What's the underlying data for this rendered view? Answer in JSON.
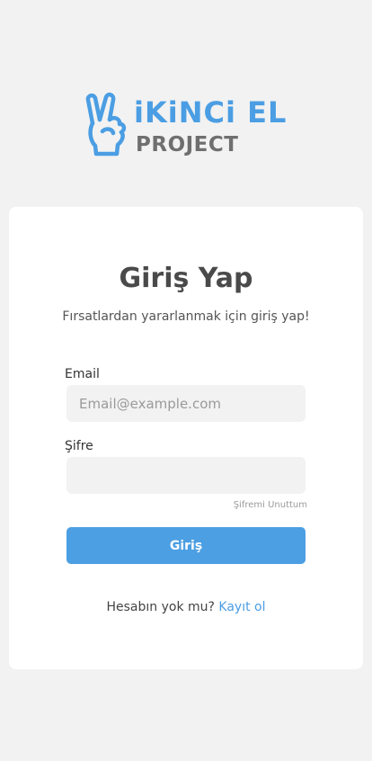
{
  "brand": {
    "logo_icon": "hand-two-fingers-icon",
    "title": "iKiNCi EL",
    "subtitle": "PROJECT",
    "colors": {
      "primary": "#4b9ee3",
      "secondary": "#6f6f6f"
    }
  },
  "login": {
    "heading": "Giriş Yap",
    "subheading": "Fırsatlardan yararlanmak için giriş yap!",
    "email_label": "Email",
    "email_placeholder": "Email@example.com",
    "email_value": "",
    "password_label": "Şifre",
    "password_value": "",
    "forgot_password": "Şifremi Unuttum",
    "submit_label": "Giriş",
    "no_account_text": "Hesabın yok mu?",
    "signup_link": "Kayıt ol"
  },
  "colors": {
    "page_background": "#f2f2f2",
    "card_background": "#ffffff",
    "button_background": "#4c9fe3",
    "link": "#4b9ee3"
  }
}
